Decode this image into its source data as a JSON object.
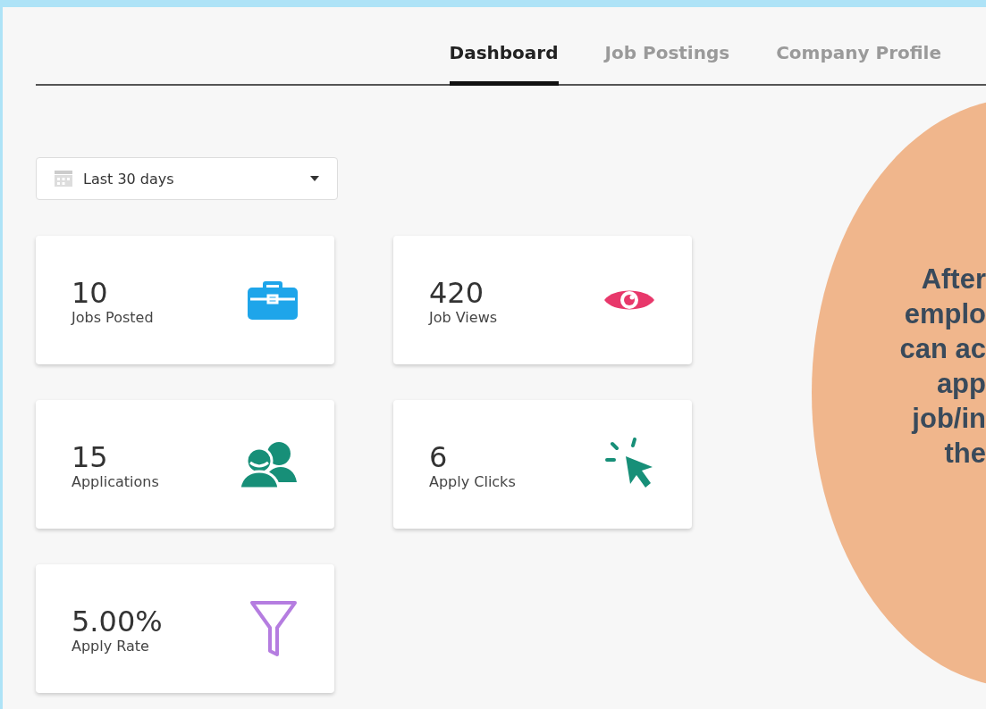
{
  "tabs": [
    {
      "label": "Dashboard",
      "selected": true
    },
    {
      "label": "Job Postings",
      "selected": false
    },
    {
      "label": "Company Profile",
      "selected": false
    }
  ],
  "date_range": {
    "value": "Last 30 days"
  },
  "stats": [
    {
      "value": "10",
      "label": "Jobs Posted",
      "color": "#1ea5ea"
    },
    {
      "value": "420",
      "label": "Job Views",
      "color": "#e8386b"
    },
    {
      "value": "15",
      "label": "Applications",
      "color": "#178f78"
    },
    {
      "value": "6",
      "label": "Apply Clicks",
      "color": "#178f78"
    },
    {
      "value": "5.00%",
      "label": "Apply Rate",
      "color": "#b57de0"
    }
  ],
  "callout": {
    "lines": [
      "After",
      "emplo",
      "can ac",
      "app",
      "job/in",
      "the"
    ]
  }
}
